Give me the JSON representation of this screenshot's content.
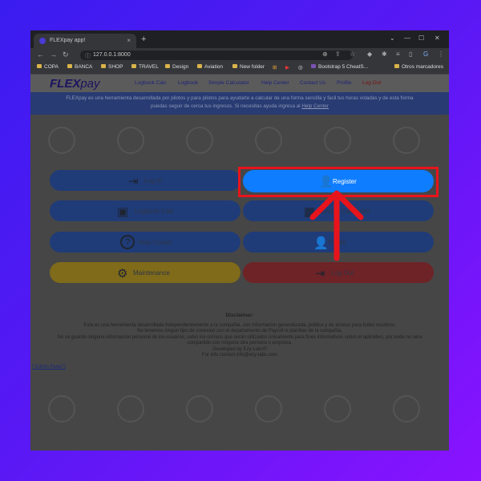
{
  "browser": {
    "tab_title": "FLEXpay app!",
    "tab_close": "×",
    "new_tab": "+",
    "window_controls": [
      "⌄",
      "—",
      "☐",
      "✕"
    ],
    "nav": [
      "←",
      "→",
      "↻"
    ],
    "lock": "ⓘ",
    "url": "127.0.0.1:8000",
    "right_icons": [
      "⊕",
      "⇪",
      "☆",
      "◆",
      "✱",
      "≡",
      "▯",
      "G",
      "⋮"
    ],
    "bookmarks": [
      "COPA",
      "BANCA",
      "SHOP",
      "TRAVEL",
      "Design",
      "Aviation",
      "New folder",
      "Bootstrap 5 CheatS...",
      "Otros marcadores"
    ],
    "bookmark_icons": [
      "⊞",
      "▶",
      "◎"
    ]
  },
  "navbar": {
    "logo_main": "FLEX",
    "logo_sub": "pay",
    "links": [
      "Logbook Calc",
      "Logbook",
      "Simple Calculator",
      "Help Center",
      "Contact Us",
      "Profile"
    ],
    "logout": "Log Out"
  },
  "banner": {
    "line1": "FLEXpay es una herramienta desarrollada por pilotos y para pilotos para ayudarte a calcular de una forma sencilla y facil tus horas voladas y de esta forma",
    "line2_prefix": "puedas seguir de cerca tus ingresos. Si necesitas ayuda ingresa al",
    "line2_link": "Help Center"
  },
  "buttons": {
    "login": "Log In",
    "register": "Register",
    "logbook_calc": "Logbook Calc",
    "simple_calc": "Simple Calculator",
    "help_center": "Help Center",
    "profile": "Profile",
    "maintenance": "Maintenance",
    "logout": "Log Out"
  },
  "icons": {
    "login": "⇥",
    "register": "👤",
    "logbook_calc": "▣",
    "simple_calc": "▦",
    "help_center": "?",
    "profile": "👤",
    "maintenance": "⚙",
    "logout": "⇥"
  },
  "disclaimer": {
    "title": "Disclaimer:",
    "lines": [
      "Esta es una herramienta desarrollada independientemente a la compañia, con informacion generalizada, publica y de acceso para todos nosotros.",
      "No tenemos ningun tipo de conexion con el departamento de Payroll ni planillas de la compañia.",
      "No se guarda ninguna información personal de los usuarios, salvo los correos que serán utilizados únicamente para fines informativos sobre el aplicativo, por ende no sera",
      "compartido con ninguna otra persona o empresa.",
      "Developed by Ezy-Labs©",
      "For info contact info@ezy-labs.com"
    ]
  },
  "admin_link": "[\"Admin Panel\"]",
  "colors": {
    "background_start": "#3a1cf0",
    "background_end": "#8a12ff",
    "register_button": "#0f7dff",
    "highlight": "#e8141c",
    "arrow": "#e8141c"
  }
}
